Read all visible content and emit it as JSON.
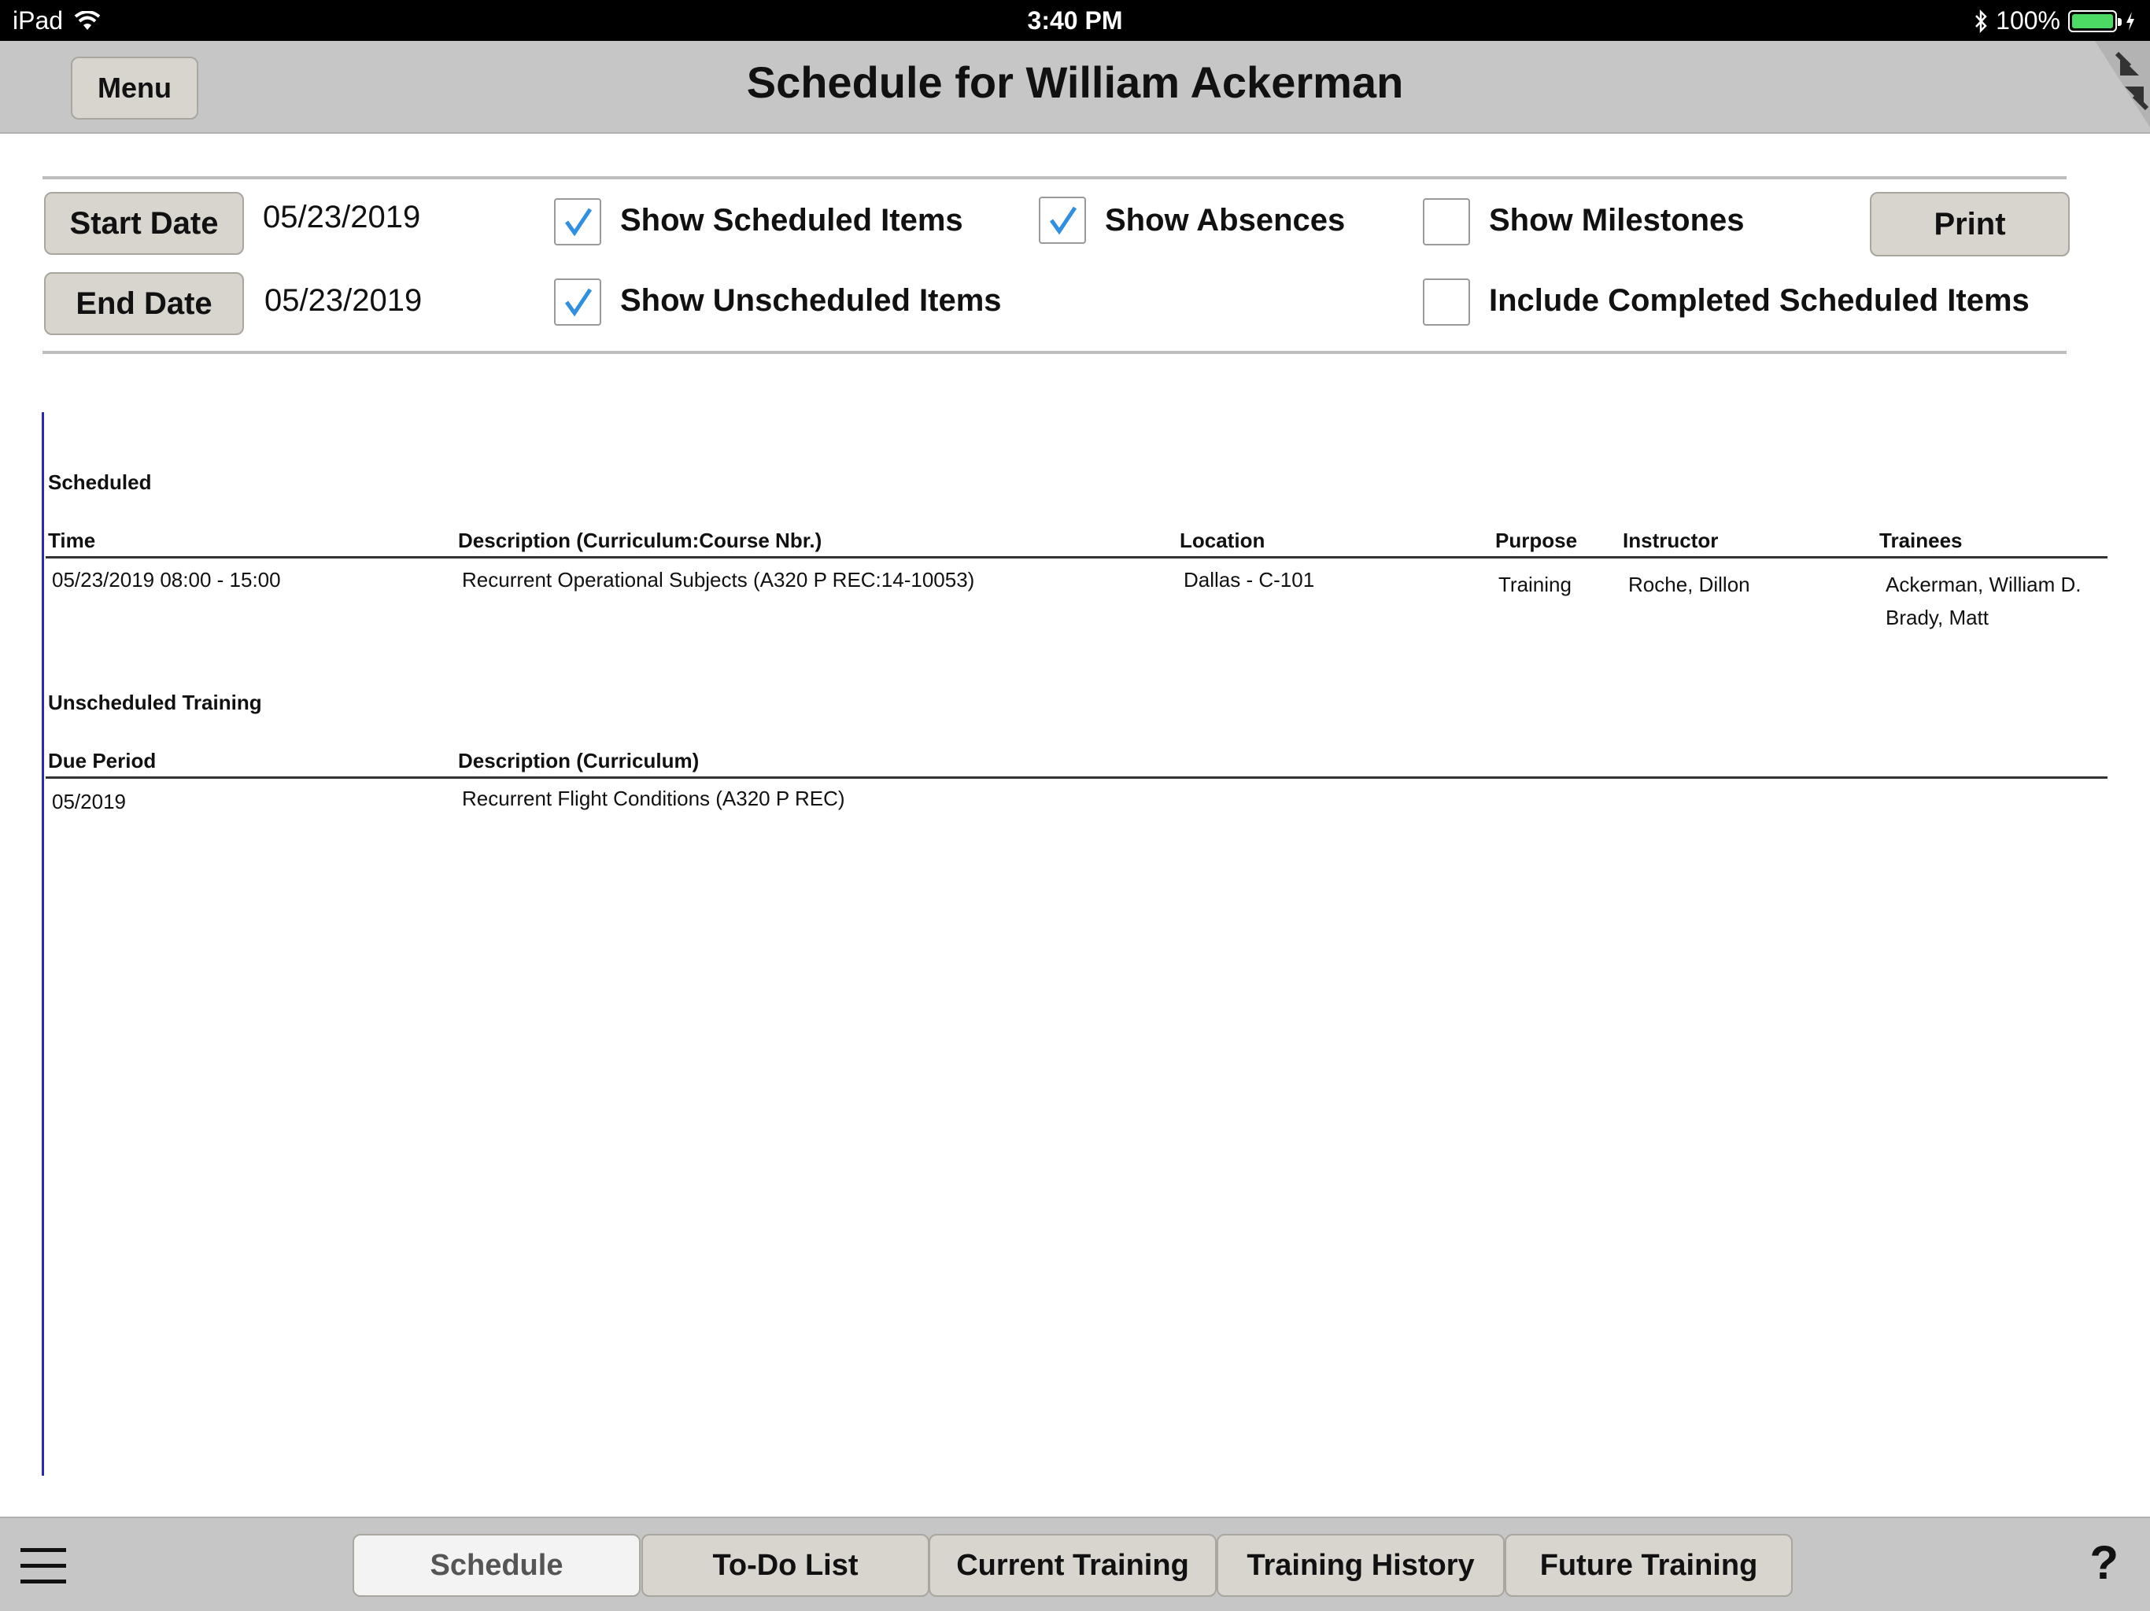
{
  "status_bar": {
    "device": "iPad",
    "time": "3:40 PM",
    "battery": "100%"
  },
  "header": {
    "menu_label": "Menu",
    "title": "Schedule for William Ackerman"
  },
  "filters": {
    "start_date_label": "Start Date",
    "start_date_value": "05/23/2019",
    "end_date_label": "End Date",
    "end_date_value": "05/23/2019",
    "show_scheduled": {
      "label": "Show Scheduled Items",
      "checked": true
    },
    "show_unscheduled": {
      "label": "Show Unscheduled Items",
      "checked": true
    },
    "show_absences": {
      "label": "Show Absences",
      "checked": true
    },
    "show_milestones": {
      "label": "Show Milestones",
      "checked": false
    },
    "include_completed": {
      "label": "Include Completed Scheduled Items",
      "checked": false
    },
    "print_label": "Print"
  },
  "scheduled": {
    "section_title": "Scheduled",
    "headers": {
      "time": "Time",
      "description": "Description (Curriculum:Course Nbr.)",
      "location": "Location",
      "purpose": "Purpose",
      "instructor": "Instructor",
      "trainees": "Trainees"
    },
    "rows": [
      {
        "time": "05/23/2019 08:00 - 15:00",
        "description": "Recurrent Operational Subjects (A320 P REC:14-10053)",
        "location": "Dallas - C-101",
        "purpose": "Training",
        "instructor": "Roche, Dillon",
        "trainees": [
          "Ackerman, William D.",
          "Brady, Matt"
        ]
      }
    ]
  },
  "unscheduled": {
    "section_title": "Unscheduled Training",
    "headers": {
      "due_period": "Due Period",
      "description": "Description (Curriculum)"
    },
    "rows": [
      {
        "due_period": "05/2019",
        "description": "Recurrent Flight Conditions (A320 P REC)"
      }
    ]
  },
  "tabs": [
    {
      "label": "Schedule",
      "active": true
    },
    {
      "label": "To-Do List",
      "active": false
    },
    {
      "label": "Current Training",
      "active": false
    },
    {
      "label": "Training History",
      "active": false
    },
    {
      "label": "Future Training",
      "active": false
    }
  ],
  "help_label": "?",
  "colors": {
    "accent": "#2f8fe0",
    "bar": "#c6c6c6",
    "button": "#d8d4ce",
    "report_line": "#2929b8",
    "battery": "#4cd964"
  }
}
